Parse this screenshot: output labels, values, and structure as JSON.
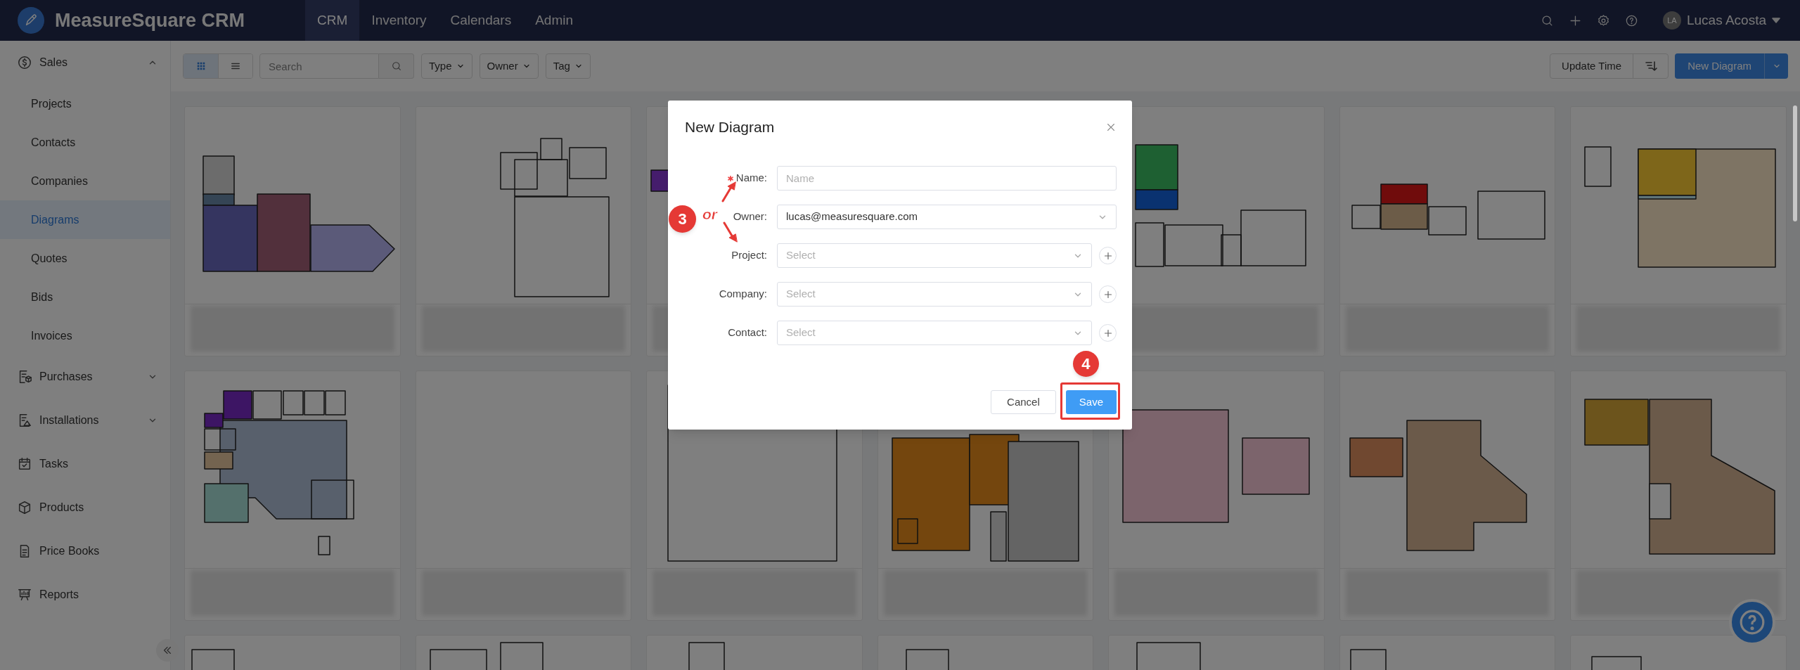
{
  "app": {
    "title": "MeasureSquare CRM"
  },
  "nav": [
    {
      "label": "CRM",
      "selected": true
    },
    {
      "label": "Inventory",
      "selected": false
    },
    {
      "label": "Calendars",
      "selected": false
    },
    {
      "label": "Admin",
      "selected": false
    }
  ],
  "user": {
    "initials": "LA",
    "name": "Lucas Acosta"
  },
  "sidebar": {
    "items": [
      {
        "label": "Sales",
        "expanded": true,
        "children": [
          {
            "label": "Projects",
            "selected": false
          },
          {
            "label": "Contacts",
            "selected": false
          },
          {
            "label": "Companies",
            "selected": false
          },
          {
            "label": "Diagrams",
            "selected": true
          },
          {
            "label": "Quotes",
            "selected": false
          },
          {
            "label": "Bids",
            "selected": false
          },
          {
            "label": "Invoices",
            "selected": false
          }
        ]
      },
      {
        "label": "Purchases",
        "expanded": false
      },
      {
        "label": "Installations",
        "expanded": false
      },
      {
        "label": "Tasks"
      },
      {
        "label": "Products"
      },
      {
        "label": "Price Books"
      },
      {
        "label": "Reports"
      }
    ]
  },
  "toolbar": {
    "views": [
      {
        "kind": "grid",
        "selected": true
      },
      {
        "kind": "list",
        "selected": false
      }
    ],
    "search": {
      "placeholder": "Search"
    },
    "filters": [
      "Type",
      "Owner",
      "Tag"
    ],
    "sort": {
      "label": "Update Time"
    },
    "primary": {
      "label": "New Diagram"
    }
  },
  "dialog": {
    "title": "New Diagram",
    "fields": [
      {
        "label": "Name:",
        "kind": "text",
        "required": true,
        "placeholder": "Name",
        "addable": false
      },
      {
        "label": "Owner:",
        "kind": "select",
        "required": false,
        "value": "lucas@measuresquare.com",
        "addable": false
      },
      {
        "label": "Project:",
        "kind": "select",
        "required": false,
        "placeholder": "Select",
        "addable": true
      },
      {
        "label": "Company:",
        "kind": "select",
        "required": false,
        "placeholder": "Select",
        "addable": true
      },
      {
        "label": "Contact:",
        "kind": "select",
        "required": false,
        "placeholder": "Select",
        "addable": true
      }
    ],
    "field_annotation": {
      "badge": "3",
      "connector": "or"
    },
    "buttons": [
      {
        "label": "Cancel",
        "kind": "default",
        "highlighted": false
      },
      {
        "label": "Save",
        "kind": "primary",
        "highlighted": true,
        "step_badge": "4"
      }
    ]
  }
}
